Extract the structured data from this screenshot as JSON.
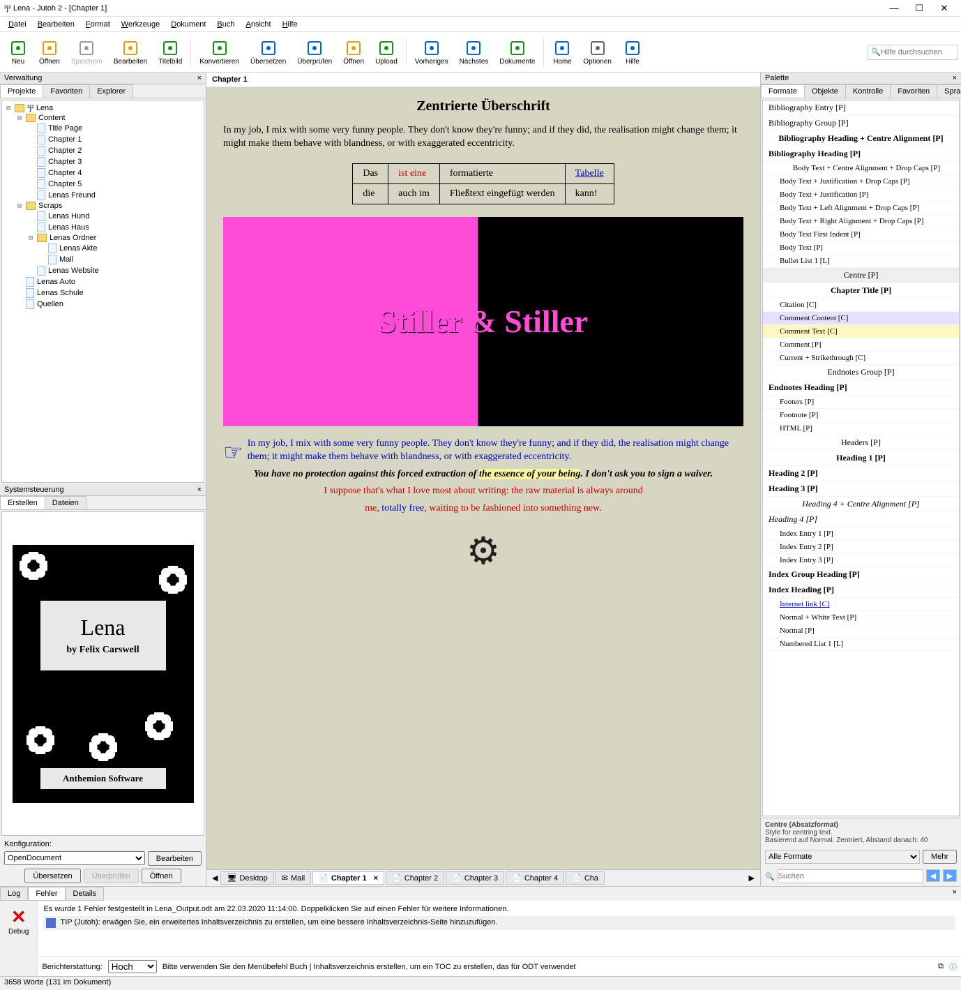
{
  "window": {
    "title": "³j² Lena - Jutoh 2 - [Chapter 1]"
  },
  "menu": [
    "Datei",
    "Bearbeiten",
    "Format",
    "Werkzeuge",
    "Dokument",
    "Buch",
    "Ansicht",
    "Hilfe"
  ],
  "toolbar": [
    {
      "label": "Neu"
    },
    {
      "label": "Öffnen"
    },
    {
      "label": "Speichern",
      "disabled": true
    },
    {
      "label": "Bearbeiten"
    },
    {
      "label": "Titelbild"
    },
    {
      "sep": true
    },
    {
      "label": "Konvertieren"
    },
    {
      "label": "Übersetzen"
    },
    {
      "label": "Überprüfen"
    },
    {
      "label": "Öffnen"
    },
    {
      "label": "Upload"
    },
    {
      "sep": true
    },
    {
      "label": "Vorheriges"
    },
    {
      "label": "Nächstes"
    },
    {
      "label": "Dokumente"
    },
    {
      "sep": true
    },
    {
      "label": "Home"
    },
    {
      "label": "Optionen"
    },
    {
      "label": "Hilfe"
    }
  ],
  "search_placeholder": "Hilfe durchsuchen",
  "leftPanel": {
    "title": "Verwaltung",
    "tabs": [
      "Projekte",
      "Favoriten",
      "Explorer"
    ],
    "tree": {
      "root": "Lena",
      "content": {
        "label": "Content",
        "items": [
          "Title Page",
          "Chapter 1",
          "Chapter 2",
          "Chapter 3",
          "Chapter 4",
          "Chapter 5",
          "Lenas Freund"
        ]
      },
      "scraps": {
        "label": "Scraps",
        "items": [
          "Lenas Hund",
          "Lenas Haus"
        ],
        "folder": {
          "label": "Lenas Ordner",
          "items": [
            "Lenas Akte",
            "Mail"
          ]
        },
        "after": [
          "Lenas Website"
        ]
      },
      "rest": [
        "Lenas Auto",
        "Lenas Schule",
        "Quellen"
      ]
    },
    "sys": {
      "title": "Systemsteuerung",
      "tabs": [
        "Erstellen",
        "Dateien"
      ]
    },
    "cover": {
      "title": "Lena",
      "author": "by Felix Carswell",
      "publisher": "Anthemion Software"
    },
    "config": {
      "label": "Konfiguration:",
      "value": "OpenDocument",
      "edit": "Bearbeiten",
      "btns": [
        "Übersetzen",
        "Überprüfen",
        "Öffnen"
      ]
    }
  },
  "doc": {
    "tab": "Chapter 1",
    "heading": "Zentrierte Überschrift",
    "p1": "In my job, I mix with some very funny people. They don't know they're funny; and if they did, the realisation might change them; it might make them behave with blandness, or with exaggerated eccentricity.",
    "table": [
      [
        "Das",
        "ist eine",
        "formatierte",
        "Tabelle"
      ],
      [
        "die",
        "auch im",
        "Fließtext eingefügt werden",
        "kann!"
      ]
    ],
    "imgtitle": "Stiller & Stiller",
    "p2a": "In my job, I mix with some very funny people. They don't know they're funny; and if they did, the realisation might change them; it might make them behave with blandness, or with exaggerated eccentricity.",
    "p3a": "You have no protection against this forced extraction of ",
    "p3b": "the essence of your being",
    "p3c": ". I don't ask you to sign a waiver.",
    "p4": "I suppose that's what I love most about writing: the raw material is always around",
    "p5a": "me, ",
    "p5b": "totally free",
    "p5c": ", waiting to be fashioned into something new.",
    "bottomTabs": [
      "Desktop",
      "Mail",
      "Chapter 1",
      "Chapter 2",
      "Chapter 3",
      "Chapter 4",
      "Cha"
    ]
  },
  "palette": {
    "title": "Palette",
    "tabs": [
      "Formate",
      "Objekte",
      "Kontrolle",
      "Favoriten",
      "Sprache"
    ],
    "styles": [
      {
        "t": "Bibliography Entry [P]"
      },
      {
        "t": "Bibliography Group [P]"
      },
      {
        "t": "Bibliography Heading + Centre Alignment [P]",
        "cls": "ctr bold"
      },
      {
        "t": "Bibliography Heading [P]",
        "cls": "bold"
      },
      {
        "t": "Body Text + Centre Alignment + Drop Caps [P]",
        "cls": "small ctr"
      },
      {
        "t": "Body Text + Justification + Drop Caps [P]",
        "cls": "small"
      },
      {
        "t": "Body Text + Justification [P]",
        "cls": "small"
      },
      {
        "t": "Body Text + Left Alignment + Drop Caps [P]",
        "cls": "small"
      },
      {
        "t": "Body Text + Right Alignment + Drop Caps [P]",
        "cls": "small"
      },
      {
        "t": "Body Text First Indent [P]",
        "cls": "small"
      },
      {
        "t": "Body Text [P]",
        "cls": "small"
      },
      {
        "t": "Bullet List 1 [L]",
        "cls": "small"
      },
      {
        "t": "Centre [P]",
        "cls": "bar"
      },
      {
        "t": "Chapter Title [P]",
        "cls": "ctr bold"
      },
      {
        "t": "Citation [C]",
        "cls": "small"
      },
      {
        "t": "Comment Content [C]",
        "cls": "hl1 small"
      },
      {
        "t": "Comment Text [C]",
        "cls": "hl2 small"
      },
      {
        "t": "Comment [P]",
        "cls": "small"
      },
      {
        "t": "Current + Strikethrough [C]",
        "cls": "small"
      },
      {
        "t": "Endnotes Group [P]",
        "cls": "ctr"
      },
      {
        "t": "Endnotes Heading [P]",
        "cls": "bold"
      },
      {
        "t": "Footers [P]",
        "cls": "small"
      },
      {
        "t": "Footnote [P]",
        "cls": "small"
      },
      {
        "t": "HTML [P]",
        "cls": "small"
      },
      {
        "t": "Headers [P]",
        "cls": "ctr"
      },
      {
        "t": "Heading 1 [P]",
        "cls": "ctr bold"
      },
      {
        "t": "Heading 2 [P]",
        "cls": "bold"
      },
      {
        "t": "Heading 3 [P]",
        "cls": "bold"
      },
      {
        "t": "Heading 4 + Centre Alignment [P]",
        "cls": "ctr ital"
      },
      {
        "t": "Heading 4 [P]",
        "cls": "ital"
      },
      {
        "t": "Index Entry 1 [P]",
        "cls": "small"
      },
      {
        "t": "Index Entry 2 [P]",
        "cls": "small"
      },
      {
        "t": "Index Entry 3 [P]",
        "cls": "small"
      },
      {
        "t": "Index Group Heading [P]",
        "cls": "bold"
      },
      {
        "t": "Index Heading [P]",
        "cls": "bold"
      },
      {
        "t": "Internet link [C]",
        "cls": "link small"
      },
      {
        "t": "Normal + White Text [P]",
        "cls": "small"
      },
      {
        "t": "Normal [P]",
        "cls": "small"
      },
      {
        "t": "Numbered List 1 [L]",
        "cls": "small"
      }
    ],
    "info": {
      "l1": "Centre (Absatzformat)",
      "l2": "Style for centring text.",
      "l3": "Basierend auf Normal. Zentriert, Abstand danach: 40"
    },
    "filter": "Alle Formate",
    "more": "Mehr",
    "search": "Suchen"
  },
  "log": {
    "tabs": [
      "Log",
      "Fehler",
      "Details"
    ],
    "line1": "Es wurde 1 Fehler festgestellt in Lena_Output.odt am 22.03.2020 11:14:00. Doppelklicken Sie auf einen Fehler für weitere Informationen.",
    "tip": "TIP (Jutoh): erwägen Sie, ein erweitertes Inhaltsverzeichnis zu erstellen, um eine bessere Inhaltsverzeichnis-Seite hinzuzufügen.",
    "debug": "Debug",
    "report": "Berichterstattung:",
    "reportval": "Hoch",
    "hint": "Bitte verwenden Sie den Menübefehl Buch | Inhaltsverzeichnis erstellen, um ein TOC zu erstellen, das für ODT verwendet"
  },
  "status": "3658 Worte (131 im Dokument)"
}
